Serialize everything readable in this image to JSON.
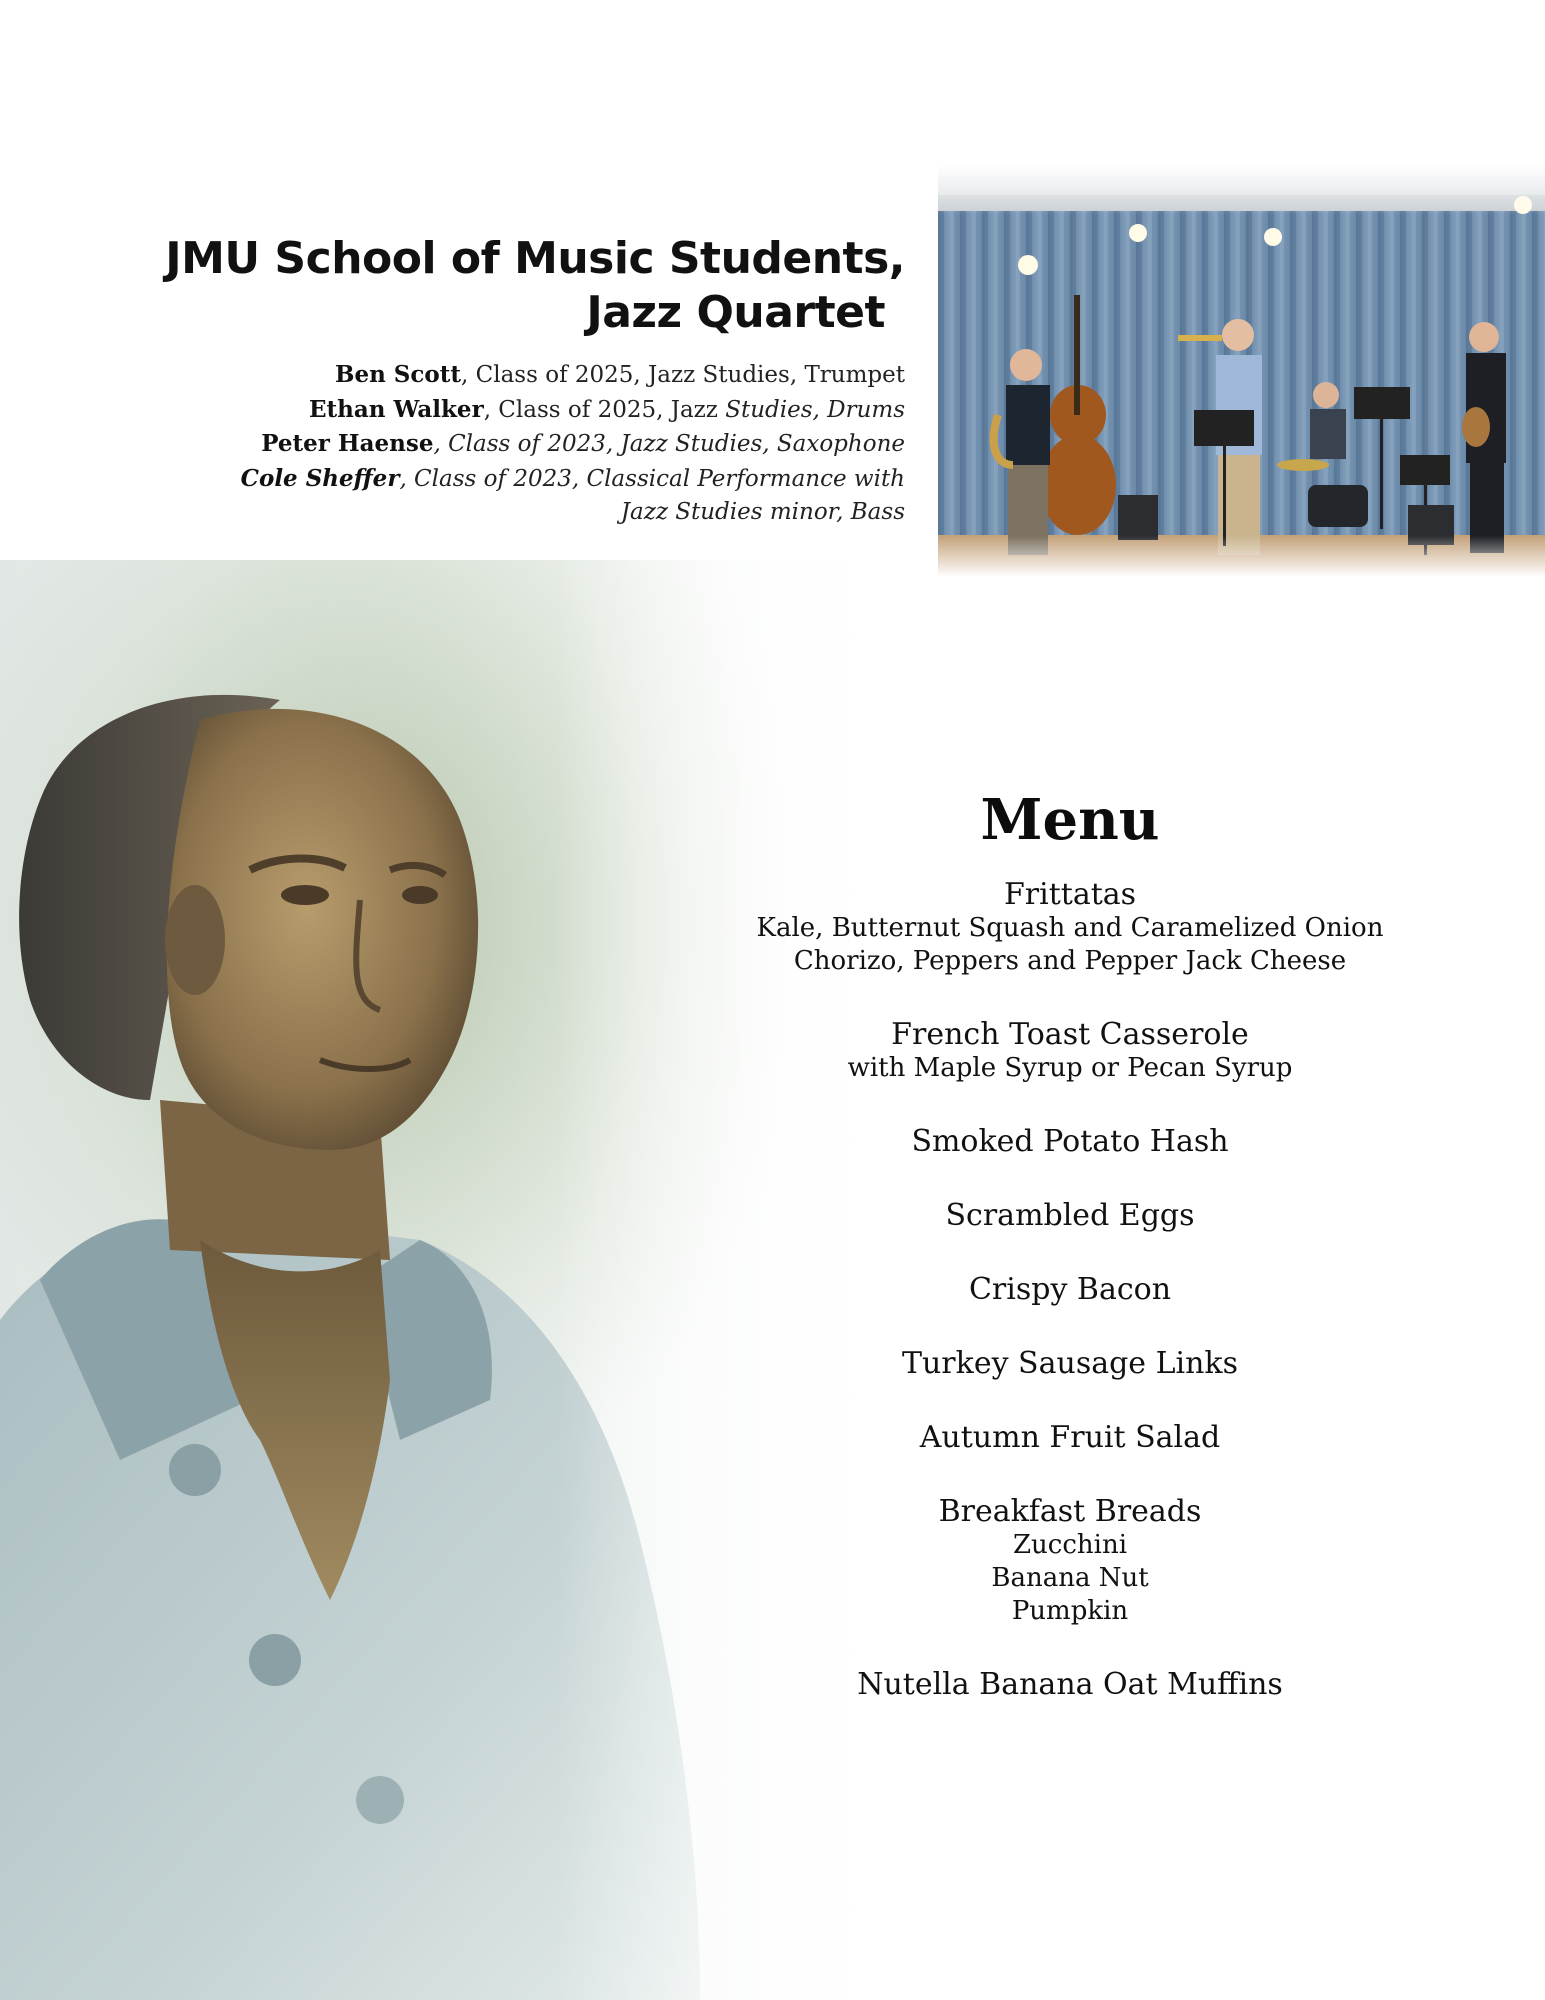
{
  "header": {
    "title_line1": "JMU School of Music Students,",
    "title_line2": "Jazz Quartet"
  },
  "performers": [
    {
      "name": "Ben Scott",
      "detail": ", Class of 2025, Jazz Studies, Trumpet"
    },
    {
      "name": "Ethan Walker",
      "detail_plain": ", Class of 2025, Jazz ",
      "detail_italic": "Studies, Drums"
    },
    {
      "name": "Peter Haense",
      "detail": ", Class of 2023, Jazz Studies, Saxophone"
    },
    {
      "name": "Cole Sheffer",
      "detail": ", Class of 2023, Classical Performance with",
      "detail2": "Jazz Studies minor, Bass"
    }
  ],
  "menu": {
    "title": "Menu",
    "items": [
      {
        "name": "Frittatas",
        "subs": [
          "Kale, Butternut Squash and Caramelized Onion",
          "Chorizo, Peppers and Pepper Jack Cheese"
        ]
      },
      {
        "name": "French Toast Casserole",
        "subs": [
          "with Maple Syrup or Pecan Syrup"
        ]
      },
      {
        "name": "Smoked Potato Hash",
        "subs": []
      },
      {
        "name": "Scrambled Eggs",
        "subs": []
      },
      {
        "name": "Crispy Bacon",
        "subs": []
      },
      {
        "name": "Turkey Sausage Links",
        "subs": []
      },
      {
        "name": "Autumn Fruit Salad",
        "subs": []
      },
      {
        "name": "Breakfast Breads",
        "subs": [
          "Zucchini",
          "Banana Nut",
          "Pumpkin"
        ]
      },
      {
        "name": "Nutella Banana Oat Muffins",
        "subs": []
      }
    ]
  },
  "colors": {
    "curtain": "#6f8fae",
    "bronze": "#8a7a55",
    "foliage": "#9bb08a"
  }
}
